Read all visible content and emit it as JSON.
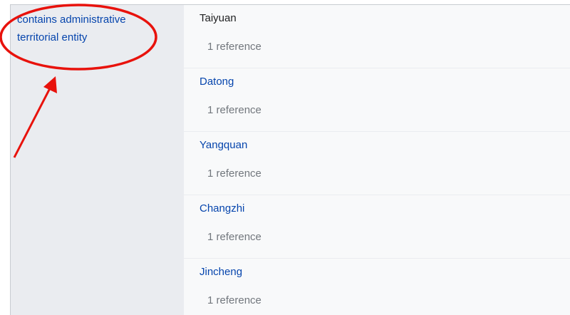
{
  "property": {
    "label": "contains administrative territorial entity"
  },
  "values": [
    {
      "name": "Taiyuan",
      "references": "1 reference"
    },
    {
      "name": "Datong",
      "references": "1 reference"
    },
    {
      "name": "Yangquan",
      "references": "1 reference"
    },
    {
      "name": "Changzhi",
      "references": "1 reference"
    },
    {
      "name": "Jincheng",
      "references": "1 reference"
    }
  ],
  "colors": {
    "link": "#0645ad",
    "reference_text": "#72777d",
    "property_background": "#eaecf0",
    "value_background": "#f8f9fa",
    "annotation_red": "#e8120c"
  },
  "annotation": {
    "shapes": [
      "red-ellipse",
      "red-arrow"
    ]
  }
}
